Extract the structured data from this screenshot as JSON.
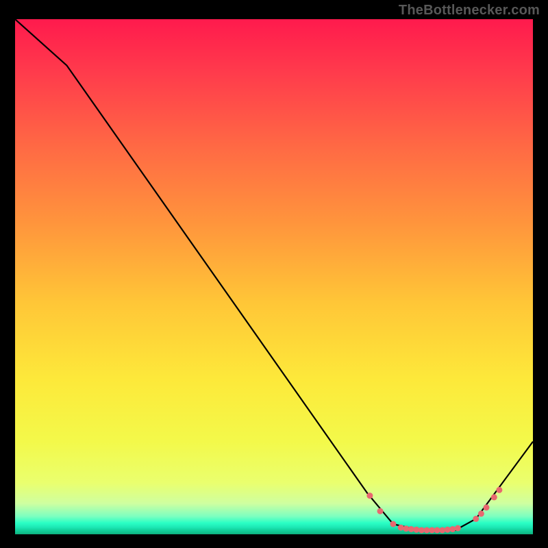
{
  "attribution": "TheBottlenecker.com",
  "colors": {
    "curve": "#000000",
    "marker": "#e86870"
  },
  "chart_data": {
    "type": "line",
    "title": "",
    "xlabel": "",
    "ylabel": "",
    "xlim": [
      0,
      100
    ],
    "ylim": [
      0,
      100
    ],
    "axes_visible": false,
    "curve": [
      {
        "x": 0,
        "y": 100
      },
      {
        "x": 10,
        "y": 91
      },
      {
        "x": 68,
        "y": 8
      },
      {
        "x": 73,
        "y": 2
      },
      {
        "x": 78,
        "y": 0.8
      },
      {
        "x": 85,
        "y": 0.8
      },
      {
        "x": 89,
        "y": 3
      },
      {
        "x": 100,
        "y": 18
      }
    ],
    "markers": [
      {
        "x": 68.5,
        "y": 7.5
      },
      {
        "x": 70.5,
        "y": 4.5
      },
      {
        "x": 73.0,
        "y": 2.0
      },
      {
        "x": 74.5,
        "y": 1.3
      },
      {
        "x": 75.5,
        "y": 1.1
      },
      {
        "x": 76.5,
        "y": 1.0
      },
      {
        "x": 77.5,
        "y": 0.9
      },
      {
        "x": 78.5,
        "y": 0.8
      },
      {
        "x": 79.5,
        "y": 0.8
      },
      {
        "x": 80.5,
        "y": 0.8
      },
      {
        "x": 81.5,
        "y": 0.8
      },
      {
        "x": 82.5,
        "y": 0.8
      },
      {
        "x": 83.5,
        "y": 0.9
      },
      {
        "x": 84.5,
        "y": 1.0
      },
      {
        "x": 85.5,
        "y": 1.2
      },
      {
        "x": 89.0,
        "y": 3.0
      },
      {
        "x": 90.0,
        "y": 4.0
      },
      {
        "x": 91.0,
        "y": 5.2
      },
      {
        "x": 92.5,
        "y": 7.2
      },
      {
        "x": 93.5,
        "y": 8.6
      }
    ]
  }
}
